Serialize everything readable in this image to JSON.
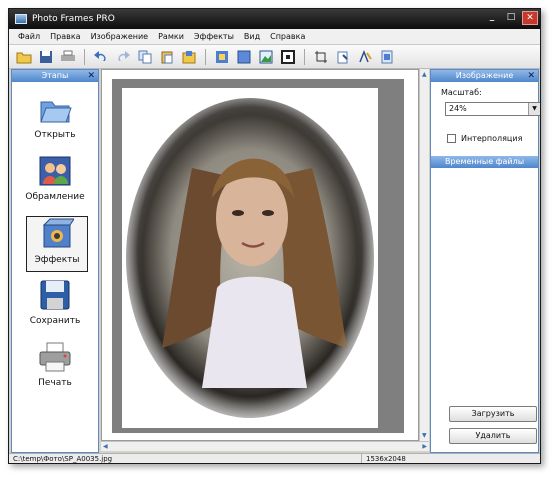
{
  "window": {
    "title": "Photo Frames PRO"
  },
  "menu": [
    "Файл",
    "Правка",
    "Изображение",
    "Рамки",
    "Эффекты",
    "Вид",
    "Справка"
  ],
  "toolbar": {
    "groups": [
      [
        "open-folder-icon",
        "save-disk-icon",
        "print-icon"
      ],
      [
        "undo-icon",
        "redo-icon",
        "copy-icon",
        "paste-icon",
        "stamp-icon"
      ],
      [
        "frame-icon",
        "fill-icon",
        "landscape-icon",
        "border-icon"
      ],
      [
        "crop-icon",
        "rotate-icon",
        "text-icon",
        "resize-icon"
      ]
    ]
  },
  "left_panel": {
    "title": "Этапы",
    "close": "✕",
    "items": [
      {
        "label": "Открыть",
        "icon": "open-folder-icon"
      },
      {
        "label": "Обрамление",
        "icon": "people-icon"
      },
      {
        "label": "Эффекты",
        "icon": "effects-box-icon"
      },
      {
        "label": "Сохранить",
        "icon": "floppy-icon"
      },
      {
        "label": "Печать",
        "icon": "printer-icon"
      }
    ]
  },
  "right_panel": {
    "title": "Изображение",
    "close": "✕",
    "scale_label": "Масштаб:",
    "scale_value": "24%",
    "interpolation_label": "Интерполяция",
    "interpolation_checked": false,
    "temp_files_title": "Временные файлы",
    "load_button": "Загрузить",
    "delete_button": "Удалить"
  },
  "status": {
    "path": "C:\\temp\\Фото\\SP_A0035.jpg",
    "dimensions": "1536x2048"
  },
  "window_controls": [
    "_",
    "□",
    "✕"
  ]
}
